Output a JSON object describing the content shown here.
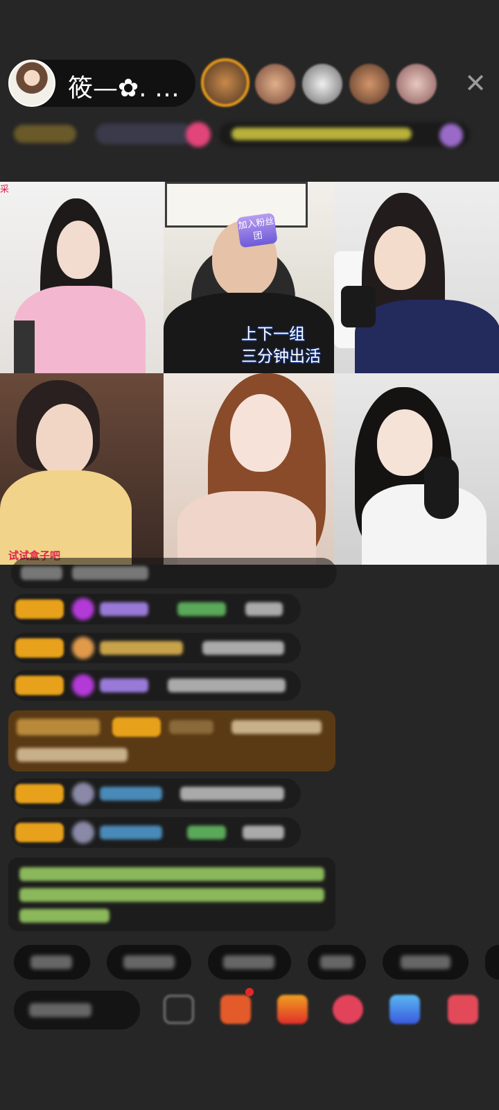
{
  "header": {
    "host_name": "筱—✿. …",
    "close_label": "✕"
  },
  "grid": {
    "tile1_corner": "采",
    "tile2_caption_line1": "上下一组",
    "tile2_caption_line2": "三分钟出活",
    "tile2_badge": "加入粉丝团",
    "tile4_bottom_text": "试试盒子吧"
  },
  "icons": {
    "close": "close-icon",
    "face_toggle": "face-icon",
    "gift_box": "gift-box-icon",
    "heart": "heart-icon"
  },
  "colors": {
    "background": "#262626",
    "accent_orange": "#e8a11a",
    "gift_highlight": "#5a3a14"
  }
}
